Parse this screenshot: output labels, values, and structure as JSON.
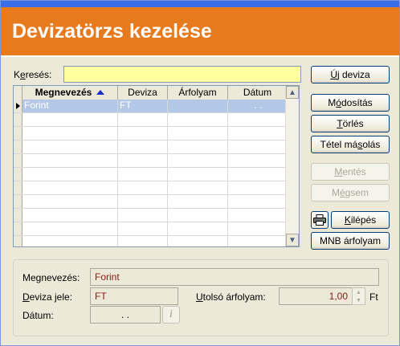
{
  "header": {
    "title": "Devizatörzs kezelése"
  },
  "search": {
    "label_pre": "K",
    "label_u": "e",
    "label_post": "resés:",
    "value": ""
  },
  "grid": {
    "columns": [
      "Megnevezés",
      "Deviza",
      "Árfolyam",
      "Dátum"
    ],
    "rows": [
      {
        "name": "Forint",
        "code": "FT",
        "rate": "",
        "date": ". ."
      }
    ]
  },
  "buttons": {
    "new": {
      "u": "Ú",
      "rest": "j deviza"
    },
    "modify": {
      "pre": "M",
      "u": "ó",
      "post": "dosítás"
    },
    "delete": {
      "u": "T",
      "post": "örlés"
    },
    "copy": {
      "pre": "Tétel má",
      "u": "s",
      "post": "olás"
    },
    "save": {
      "pre": "",
      "u": "M",
      "post": "entés"
    },
    "cancel": {
      "pre": "M",
      "u": "é",
      "post": "gsem"
    },
    "exit": {
      "u": "K",
      "post": "ilépés"
    },
    "mnb": "MNB árfolyam"
  },
  "details": {
    "name_label": "Megnevezés:",
    "name_value": "Forint",
    "code_label_u": "D",
    "code_label_rest": "eviza jele:",
    "code_value": "FT",
    "last_rate_label_u": "U",
    "last_rate_label_rest": "tolsó árfolyam:",
    "last_rate_value": "1,00",
    "unit": "Ft",
    "date_label": "Dátum:",
    "date_value": ". .",
    "info_symbol": "i"
  },
  "colors": {
    "header": "#e87a1e",
    "selection": "#b3c7e6",
    "search_bg": "#ffffa0"
  }
}
